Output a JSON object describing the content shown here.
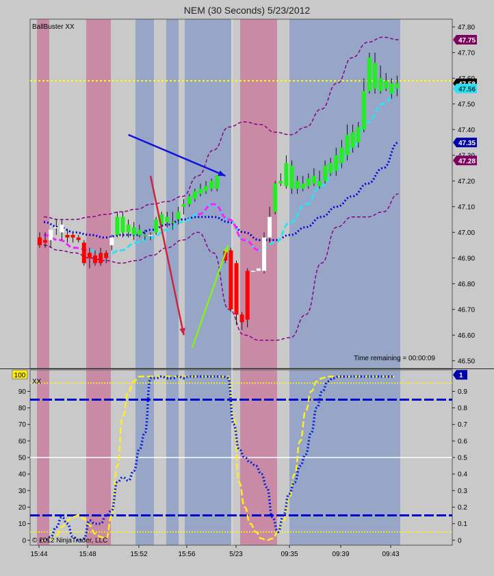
{
  "title": "NEM (30 Seconds)  5/23/2012",
  "colors": {
    "background": "#c9c9c9",
    "pink_band": "#c98aa6",
    "blue_band": "#97a6c6",
    "up_candle": "#22ee22",
    "down_candle": "#ff0000",
    "doji_candle": "#ffffff",
    "bollinger": "#880088",
    "fast_ma": "#30e0f0",
    "fast_ma_down": "#ff20ff",
    "slow_ma": "#0000dd",
    "yellow_level": "#ffff00",
    "osc_yellow": "#ffee22",
    "osc_blue": "#0022dd"
  },
  "chart_data": [
    {
      "type": "candlestick",
      "indicator_label": "BallBuster XX",
      "time_remaining": "Time remaining = 00:00:09",
      "x_tick_labels": [
        "15:44",
        "15:48",
        "15:52",
        "15:56",
        "5/23",
        "09:35",
        "09:39",
        "09:43"
      ],
      "y_ticks": [
        47.8,
        47.7,
        47.6,
        47.5,
        47.4,
        47.3,
        47.2,
        47.1,
        47.0,
        46.9,
        46.8,
        46.7,
        46.6,
        46.5
      ],
      "ylim": [
        46.47,
        47.83
      ],
      "price_markers": [
        {
          "label": "47.75",
          "value": 47.75,
          "color": "#800060"
        },
        {
          "label": "47.58",
          "value": 47.58,
          "color": "#000000"
        },
        {
          "label": "47.56",
          "value": 47.56,
          "color": "#30e0f0"
        },
        {
          "label": "47.35",
          "value": 47.35,
          "color": "#0000aa"
        },
        {
          "label": "47.28",
          "value": 47.28,
          "color": "#800060"
        }
      ],
      "horizontal_line": 47.59,
      "candles": [
        {
          "o": 46.98,
          "h": 47.0,
          "l": 46.94,
          "c": 46.95,
          "dir": "down"
        },
        {
          "o": 46.97,
          "h": 47.0,
          "l": 46.94,
          "c": 46.96,
          "dir": "down"
        },
        {
          "o": 46.97,
          "h": 47.0,
          "l": 46.94,
          "c": 47.01,
          "dir": "doji"
        },
        {
          "o": 47.02,
          "h": 47.05,
          "l": 46.99,
          "c": 47.02,
          "dir": "doji"
        },
        {
          "o": 47.0,
          "h": 47.05,
          "l": 46.97,
          "c": 47.03,
          "dir": "doji"
        },
        {
          "o": 46.99,
          "h": 47.01,
          "l": 46.96,
          "c": 46.98,
          "dir": "down"
        },
        {
          "o": 46.99,
          "h": 47.0,
          "l": 46.96,
          "c": 46.98,
          "dir": "down"
        },
        {
          "o": 46.98,
          "h": 46.99,
          "l": 46.96,
          "c": 46.97,
          "dir": "down"
        },
        {
          "o": 46.96,
          "h": 46.97,
          "l": 46.87,
          "c": 46.88,
          "dir": "down"
        },
        {
          "o": 46.92,
          "h": 46.94,
          "l": 46.86,
          "c": 46.9,
          "dir": "down"
        },
        {
          "o": 46.91,
          "h": 46.93,
          "l": 46.87,
          "c": 46.88,
          "dir": "down"
        },
        {
          "o": 46.92,
          "h": 46.94,
          "l": 46.87,
          "c": 46.88,
          "dir": "down"
        },
        {
          "o": 46.9,
          "h": 46.93,
          "l": 46.88,
          "c": 46.92,
          "dir": "down"
        },
        {
          "o": 46.95,
          "h": 46.99,
          "l": 46.93,
          "c": 46.98,
          "dir": "doji"
        },
        {
          "o": 46.99,
          "h": 47.08,
          "l": 46.98,
          "c": 47.06,
          "dir": "up"
        },
        {
          "o": 47.0,
          "h": 47.08,
          "l": 46.98,
          "c": 47.06,
          "dir": "up"
        },
        {
          "o": 47.0,
          "h": 47.05,
          "l": 46.98,
          "c": 47.03,
          "dir": "up"
        },
        {
          "o": 46.99,
          "h": 47.04,
          "l": 46.97,
          "c": 47.02,
          "dir": "up"
        },
        {
          "o": 46.99,
          "h": 47.03,
          "l": 46.98,
          "c": 47.01,
          "dir": "up"
        },
        {
          "o": 46.99,
          "h": 47.01,
          "l": 46.97,
          "c": 46.99,
          "dir": "up"
        },
        {
          "o": 46.99,
          "h": 47.0,
          "l": 46.97,
          "c": 46.99,
          "dir": "doji"
        },
        {
          "o": 47.0,
          "h": 47.06,
          "l": 46.99,
          "c": 47.05,
          "dir": "up"
        },
        {
          "o": 47.03,
          "h": 47.08,
          "l": 47.02,
          "c": 47.07,
          "dir": "up"
        },
        {
          "o": 47.04,
          "h": 47.08,
          "l": 47.02,
          "c": 47.06,
          "dir": "up"
        },
        {
          "o": 47.04,
          "h": 47.08,
          "l": 47.01,
          "c": 47.04,
          "dir": "up"
        },
        {
          "o": 47.05,
          "h": 47.1,
          "l": 47.03,
          "c": 47.08,
          "dir": "up"
        },
        {
          "o": 47.1,
          "h": 47.13,
          "l": 47.07,
          "c": 47.11,
          "dir": "up"
        },
        {
          "o": 47.11,
          "h": 47.15,
          "l": 47.1,
          "c": 47.14,
          "dir": "up"
        },
        {
          "o": 47.13,
          "h": 47.17,
          "l": 47.12,
          "c": 47.16,
          "dir": "up"
        },
        {
          "o": 47.15,
          "h": 47.19,
          "l": 47.14,
          "c": 47.17,
          "dir": "up"
        },
        {
          "o": 47.16,
          "h": 47.2,
          "l": 47.15,
          "c": 47.18,
          "dir": "up"
        },
        {
          "o": 47.17,
          "h": 47.21,
          "l": 47.16,
          "c": 47.2,
          "dir": "up"
        },
        {
          "o": 47.17,
          "h": 47.22,
          "l": 47.16,
          "c": 47.22,
          "dir": "up"
        },
        {
          "o": 46.93,
          "h": 46.93,
          "l": 46.88,
          "c": 46.89,
          "dir": "down"
        },
        {
          "o": 46.93,
          "h": 46.94,
          "l": 46.69,
          "c": 46.7,
          "dir": "down"
        },
        {
          "o": 46.88,
          "h": 46.89,
          "l": 46.64,
          "c": 46.68,
          "dir": "down"
        },
        {
          "o": 46.68,
          "h": 46.69,
          "l": 46.62,
          "c": 46.65,
          "dir": "down"
        },
        {
          "o": 46.85,
          "h": 46.86,
          "l": 46.63,
          "c": 46.66,
          "dir": "down"
        },
        {
          "o": 46.85,
          "h": 46.85,
          "l": 46.85,
          "c": 46.85,
          "dir": "doji"
        },
        {
          "o": 46.86,
          "h": 46.86,
          "l": 46.85,
          "c": 46.85,
          "dir": "doji"
        },
        {
          "o": 46.85,
          "h": 47.0,
          "l": 46.84,
          "c": 46.98,
          "dir": "doji"
        },
        {
          "o": 46.98,
          "h": 47.1,
          "l": 46.96,
          "c": 47.06,
          "dir": "doji"
        },
        {
          "o": 47.08,
          "h": 47.2,
          "l": 47.07,
          "c": 47.19,
          "dir": "up"
        },
        {
          "o": 47.19,
          "h": 47.23,
          "l": 47.18,
          "c": 47.2,
          "dir": "up"
        },
        {
          "o": 47.18,
          "h": 47.3,
          "l": 47.17,
          "c": 47.27,
          "dir": "up"
        },
        {
          "o": 47.17,
          "h": 47.28,
          "l": 47.15,
          "c": 47.26,
          "dir": "up"
        },
        {
          "o": 47.17,
          "h": 47.22,
          "l": 47.15,
          "c": 47.2,
          "dir": "up"
        },
        {
          "o": 47.17,
          "h": 47.22,
          "l": 47.16,
          "c": 47.19,
          "dir": "up"
        },
        {
          "o": 47.18,
          "h": 47.23,
          "l": 47.17,
          "c": 47.21,
          "dir": "up"
        },
        {
          "o": 47.19,
          "h": 47.25,
          "l": 47.18,
          "c": 47.22,
          "dir": "up"
        },
        {
          "o": 47.18,
          "h": 47.24,
          "l": 47.17,
          "c": 47.2,
          "dir": "up"
        },
        {
          "o": 47.2,
          "h": 47.28,
          "l": 47.19,
          "c": 47.26,
          "dir": "up"
        },
        {
          "o": 47.23,
          "h": 47.29,
          "l": 47.22,
          "c": 47.27,
          "dir": "up"
        },
        {
          "o": 47.24,
          "h": 47.33,
          "l": 47.22,
          "c": 47.3,
          "dir": "up"
        },
        {
          "o": 47.27,
          "h": 47.36,
          "l": 47.25,
          "c": 47.33,
          "dir": "up"
        },
        {
          "o": 47.3,
          "h": 47.42,
          "l": 47.28,
          "c": 47.38,
          "dir": "up"
        },
        {
          "o": 47.33,
          "h": 47.42,
          "l": 47.31,
          "c": 47.39,
          "dir": "up"
        },
        {
          "o": 47.35,
          "h": 47.43,
          "l": 47.33,
          "c": 47.41,
          "dir": "up"
        },
        {
          "o": 47.4,
          "h": 47.6,
          "l": 47.39,
          "c": 47.55,
          "dir": "up"
        },
        {
          "o": 47.55,
          "h": 47.7,
          "l": 47.54,
          "c": 47.68,
          "dir": "up"
        },
        {
          "o": 47.56,
          "h": 47.7,
          "l": 47.54,
          "c": 47.66,
          "dir": "up"
        },
        {
          "o": 47.55,
          "h": 47.65,
          "l": 47.54,
          "c": 47.6,
          "dir": "up"
        },
        {
          "o": 47.56,
          "h": 47.62,
          "l": 47.55,
          "c": 47.59,
          "dir": "up"
        },
        {
          "o": 47.54,
          "h": 47.6,
          "l": 47.52,
          "c": 47.58,
          "dir": "up"
        },
        {
          "o": 47.56,
          "h": 47.61,
          "l": 47.53,
          "c": 47.58,
          "dir": "up"
        }
      ],
      "bollinger_upper": [
        47.06,
        47.05,
        47.05,
        47.06,
        47.07,
        47.08,
        47.09,
        47.11,
        47.12,
        47.14,
        47.22,
        47.32,
        47.41,
        47.43,
        47.42,
        47.39,
        47.38,
        47.41,
        47.48,
        47.58,
        47.68,
        47.74,
        47.76,
        47.75
      ],
      "bollinger_lower": [
        46.95,
        46.93,
        46.92,
        46.9,
        46.89,
        46.88,
        46.89,
        46.91,
        46.94,
        46.97,
        47.0,
        46.92,
        46.7,
        46.6,
        46.58,
        46.58,
        46.59,
        46.68,
        46.88,
        47.02,
        47.06,
        47.06,
        47.08,
        47.15
      ],
      "fast_ma": [
        46.99,
        46.97,
        46.94,
        46.93,
        46.91,
        46.93,
        46.96,
        46.98,
        47.01,
        47.04,
        47.07,
        47.11,
        47.05,
        46.97,
        46.93,
        46.96,
        47.04,
        47.11,
        47.18,
        47.25,
        47.33,
        47.43,
        47.5,
        47.56
      ],
      "slow_ma": [
        47.04,
        47.02,
        47.0,
        46.99,
        46.98,
        46.99,
        46.99,
        47.01,
        47.03,
        47.05,
        47.06,
        47.06,
        47.04,
        47.0,
        46.97,
        46.97,
        46.99,
        47.02,
        47.06,
        47.1,
        47.14,
        47.19,
        47.25,
        47.35
      ],
      "annotations": [
        {
          "type": "arrow",
          "color": "#1111dd",
          "from": [
            16,
            47.38
          ],
          "to": [
            33.5,
            47.22
          ]
        },
        {
          "type": "arrow",
          "color": "#cc2244",
          "from": [
            20,
            47.22
          ],
          "to": [
            26,
            46.6
          ]
        },
        {
          "type": "arrow",
          "color": "#88ee22",
          "from": [
            27.5,
            46.55
          ],
          "to": [
            34,
            46.95
          ]
        }
      ]
    },
    {
      "type": "line",
      "indicator_label": "XX",
      "y_ticks": [
        0,
        10,
        20,
        30,
        40,
        50,
        60,
        70,
        80,
        90
      ],
      "y_ticks_right": [
        "0",
        "0.1",
        "0.2",
        "0.3",
        "0.4",
        "0.5",
        "0.6",
        "0.7",
        "0.8",
        "0.9"
      ],
      "ylim": [
        -3,
        103
      ],
      "left_marker": "100",
      "right_marker": "1",
      "reference_lines": [
        {
          "value": 95,
          "style": "dotted",
          "color": "#ffff00"
        },
        {
          "value": 85,
          "style": "dashed",
          "color": "#0000cc"
        },
        {
          "value": 50,
          "style": "solid",
          "color": "#ffffff"
        },
        {
          "value": 15,
          "style": "dashed",
          "color": "#0000cc"
        },
        {
          "value": 5,
          "style": "dotted",
          "color": "#ffff00"
        }
      ],
      "series": [
        {
          "values": [
            0,
            0,
            1,
            3,
            8,
            12,
            14,
            15,
            13,
            9,
            4,
            2,
            1,
            15,
            45,
            75,
            90,
            96,
            99,
            99,
            99,
            99,
            99,
            99,
            99,
            99,
            99,
            99,
            99,
            99,
            99,
            99,
            99,
            99,
            99,
            75,
            35,
            20,
            10,
            5,
            1,
            0,
            1,
            5,
            12,
            25,
            40,
            60,
            78,
            90,
            96,
            98,
            99,
            99,
            99,
            99,
            99,
            99,
            99,
            99,
            99,
            99,
            99,
            99,
            99
          ]
        },
        {
          "values": [
            0,
            0,
            2,
            8,
            14,
            10,
            2,
            0,
            1,
            12,
            10,
            10,
            15,
            18,
            35,
            38,
            36,
            42,
            55,
            65,
            98,
            98,
            99,
            98,
            98,
            99,
            98,
            99,
            99,
            99,
            99,
            99,
            99,
            99,
            98,
            70,
            55,
            50,
            47,
            45,
            40,
            32,
            14,
            5,
            15,
            28,
            35,
            45,
            52,
            65,
            80,
            90,
            96,
            98,
            99,
            99,
            99,
            99,
            99,
            99,
            99,
            99,
            99,
            99,
            99
          ]
        }
      ]
    }
  ],
  "copyright": "© 2012 NinjaTrader, LLC"
}
